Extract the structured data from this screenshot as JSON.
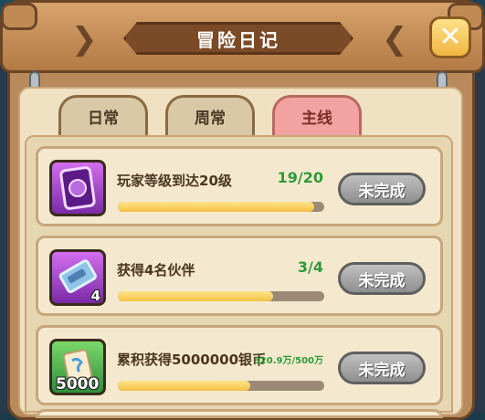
{
  "header": {
    "title": "冒险日记"
  },
  "close_icon_glyph": "✕",
  "nav": {
    "prev_glyph": "❮",
    "next_glyph": "❯"
  },
  "tabs": [
    {
      "label": "日常",
      "active": false
    },
    {
      "label": "周常",
      "active": false
    },
    {
      "label": "主线",
      "active": true
    }
  ],
  "tasks": [
    {
      "icon": "purple-card-icon",
      "count": "",
      "name": "玩家等级到达20级",
      "progress": "19/20",
      "fraction": 0.95,
      "status": "未完成"
    },
    {
      "icon": "ticket-icon",
      "count": "4",
      "name": "获得4名伙伴",
      "progress": "3/4",
      "fraction": 0.75,
      "status": "未完成"
    },
    {
      "icon": "scroll-icon",
      "count": "5000",
      "name": "累积获得5000000银币",
      "progress": "320.9万/500万",
      "fraction": 0.64,
      "status": "未完成"
    }
  ],
  "colors": {
    "progress_text": "#2f9a3a",
    "active_tab": "#f2a2a0",
    "bar_fill": "#f5c043"
  }
}
